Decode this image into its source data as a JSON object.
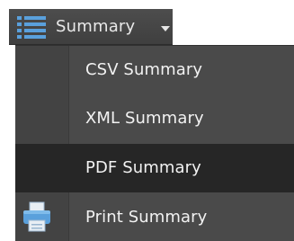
{
  "dropdown": {
    "label": "Summary",
    "icon": "list-icon",
    "caret_icon": "caret-down-icon"
  },
  "menu": {
    "items": [
      {
        "label": "CSV Summary",
        "icon": "",
        "selected": false
      },
      {
        "label": "XML Summary",
        "icon": "",
        "selected": false
      },
      {
        "label": "PDF Summary",
        "icon": "",
        "selected": true
      },
      {
        "label": "Print Summary",
        "icon": "printer-icon",
        "selected": false
      }
    ]
  },
  "colors": {
    "menu_background": "#4a4a4a",
    "selected_background": "#262626",
    "icon_blue": "#5aa0dc",
    "text": "#f2f2f2"
  }
}
